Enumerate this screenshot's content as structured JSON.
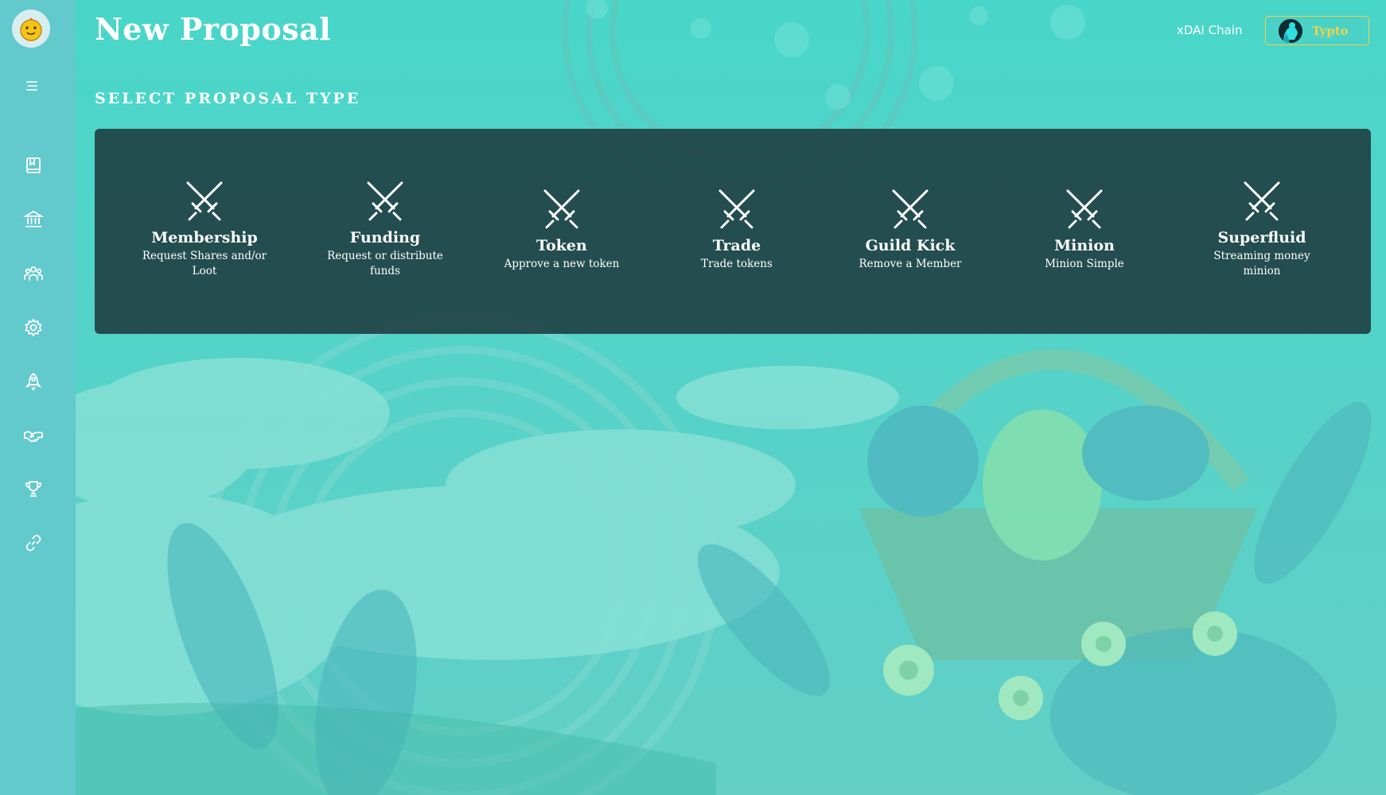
{
  "header": {
    "title": "New Proposal",
    "chain": "xDAI Chain",
    "account_name": "Typto"
  },
  "section": {
    "heading": "SELECT PROPOSAL TYPE"
  },
  "proposal_types": [
    {
      "title": "Membership",
      "description": "Request Shares and/or Loot"
    },
    {
      "title": "Funding",
      "description": "Request or distribute funds"
    },
    {
      "title": "Token",
      "description": "Approve a new token"
    },
    {
      "title": "Trade",
      "description": "Trade tokens"
    },
    {
      "title": "Guild Kick",
      "description": "Remove a Member"
    },
    {
      "title": "Minion",
      "description": "Minion Simple"
    },
    {
      "title": "Superfluid",
      "description": "Streaming money minion"
    }
  ],
  "sidebar": {
    "icons": [
      "menu-icon",
      "book-icon",
      "bank-icon",
      "members-icon",
      "gear-icon",
      "rocket-icon",
      "handshake-icon",
      "trophy-icon",
      "link-icon"
    ]
  },
  "colors": {
    "accent": "#f2d24a",
    "panel": "#1a3034",
    "sidebar": "#62c9cd",
    "background": "#5fcfc6"
  }
}
